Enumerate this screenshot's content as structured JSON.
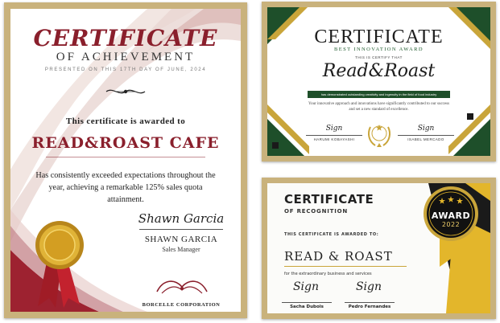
{
  "certificates": {
    "achievement": {
      "title": "CERTIFICATE",
      "subtitle": "OF ACHIEVEMENT",
      "presented_line": "PRESENTED ON THIS 17TH DAY OF JUNE, 2024",
      "awarded_to_label": "This certificate is awarded to",
      "recipient": "READ&ROAST CAFE",
      "description": "Has consistently exceeded expectations throughout the year, achieving a remarkable 125% sales quota attainment.",
      "signature_text": "Shawn Garcia",
      "signer_name": "SHAWN GARCIA",
      "signer_title": "Sales Manager",
      "organization": "BORCELLE CORPORATION",
      "colors": {
        "accent": "#8a1f2c",
        "frame": "#c9b27c",
        "seal_gold": "#d9a520"
      }
    },
    "innovation": {
      "title": "CERTIFICATE",
      "subtitle": "BEST INNOVATION AWARD",
      "proudly_line": "THIS IS CERTIFY THAT",
      "recipient": "Read&Roast",
      "banner_text": "has demonstrated outstanding creativity and ingenuity in the field of food industry",
      "description": "Your innovative approach and innovations have significantly contributed to our success and set a new standard of excellence.",
      "signature_left": "Sign",
      "signature_right": "Sign",
      "signer_left": "HARUMI KOBAYASHI",
      "signer_right": "ISABEL MERCADO",
      "badge_text": "AWARD WINNING",
      "colors": {
        "accent": "#1e4f2a",
        "gold": "#c9a53a"
      }
    },
    "recognition": {
      "title": "CERTIFICATE",
      "subtitle": "OF RECOGNITION",
      "awarded_to_label": "THIS CERTIFICATE IS AWARDED TO:",
      "recipient": "READ & ROAST",
      "description": "for the extraordinary business and services",
      "signature_left": "Sign",
      "signature_right": "Sign",
      "signer_left": "Sacha Dubois",
      "signer_right": "Pedro Fernandes",
      "award_label": "AWARD",
      "award_year": "2022",
      "colors": {
        "dark": "#1a1a1a",
        "gold": "#e3b62b"
      }
    }
  }
}
